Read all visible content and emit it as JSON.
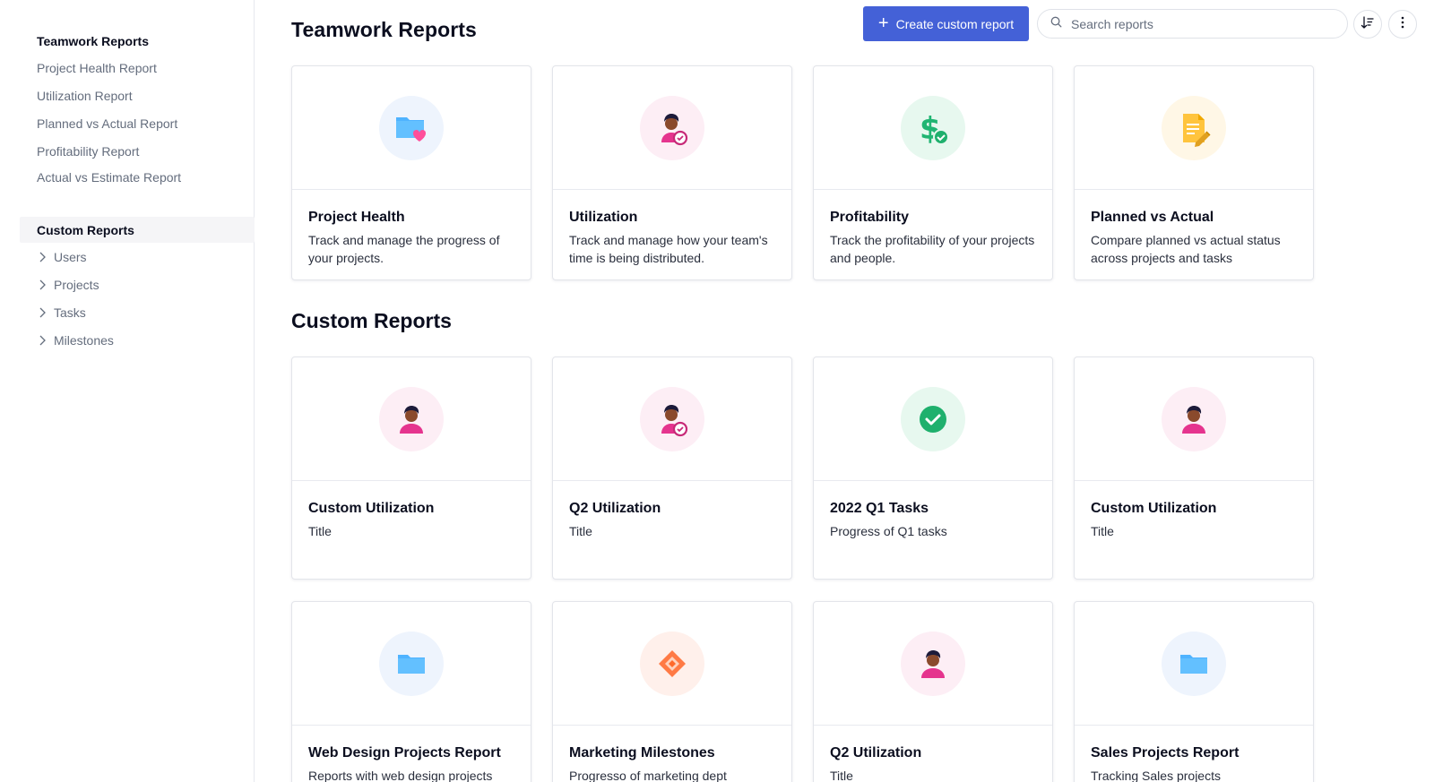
{
  "sidebar": {
    "teamwork_title": "Teamwork Reports",
    "teamwork_links": [
      "Project Health Report",
      "Utilization Report",
      "Planned vs Actual Report",
      "Profitability Report",
      "Actual vs Estimate Report"
    ],
    "custom_title": "Custom Reports",
    "custom_items": [
      "Users",
      "Projects",
      "Tasks",
      "Milestones"
    ]
  },
  "header": {
    "title": "Teamwork Reports",
    "create_button": "Create custom report",
    "search_placeholder": "Search reports",
    "sort_icon": "sort-icon",
    "more_icon": "more-vertical-icon"
  },
  "teamwork_cards": [
    {
      "title": "Project Health",
      "desc": "Track and manage the progress of your projects.",
      "icon": "folder-heart-icon"
    },
    {
      "title": "Utilization",
      "desc": "Track and manage how your team's time is being distributed.",
      "icon": "user-clock-icon"
    },
    {
      "title": "Profitability",
      "desc": "Track the profitability of your projects and people.",
      "icon": "dollar-check-icon"
    },
    {
      "title": "Planned vs Actual",
      "desc": "Compare planned vs actual status across projects and tasks",
      "icon": "document-pencil-icon"
    }
  ],
  "custom_section_title": "Custom Reports",
  "custom_cards": [
    {
      "title": "Custom Utilization",
      "desc": "Title",
      "icon": "user-icon"
    },
    {
      "title": "Q2 Utilization",
      "desc": "Title",
      "icon": "user-clock-icon"
    },
    {
      "title": "2022 Q1 Tasks",
      "desc": "Progress of Q1 tasks",
      "icon": "check-circle-icon"
    },
    {
      "title": "Custom Utilization",
      "desc": "Title",
      "icon": "user-icon"
    },
    {
      "title": "Web Design Projects Report",
      "desc": "Reports with web design projects",
      "icon": "folder-icon"
    },
    {
      "title": "Marketing Milestones",
      "desc": "Progresso of marketing dept",
      "icon": "milestone-diamond-icon"
    },
    {
      "title": "Q2 Utilization",
      "desc": "Title",
      "icon": "user-icon"
    },
    {
      "title": "Sales Projects Report",
      "desc": "Tracking Sales projects",
      "icon": "folder-icon"
    }
  ],
  "colors": {
    "accent": "#4461d7",
    "blue_tint": "#eef4fd",
    "pink_tint": "#fdeef5",
    "green_tint": "#e7f8ef",
    "yellow_tint": "#fff7e6",
    "orange_tint": "#fff0eb"
  }
}
